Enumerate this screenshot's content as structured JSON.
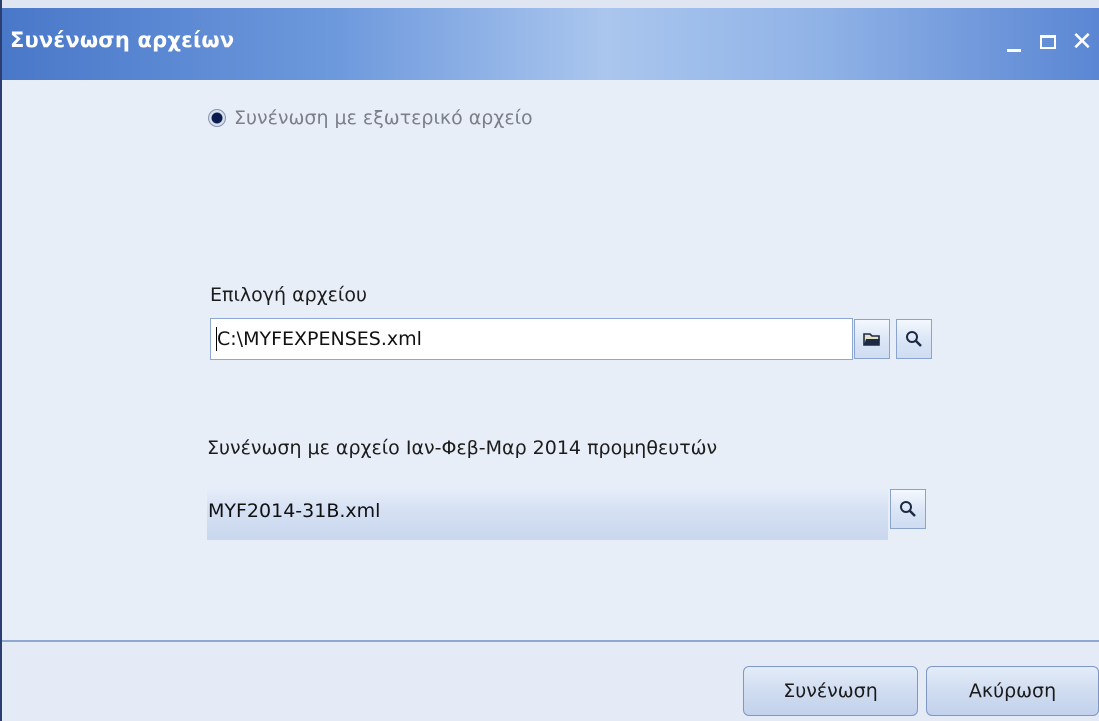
{
  "window": {
    "title": "Συνένωση αρχείων",
    "controls": {
      "minimize": "minimize-icon",
      "maximize": "maximize-icon",
      "close": "close-icon"
    }
  },
  "radio": {
    "label": "Συνένωση με εξωτερικό αρχείο",
    "selected": true
  },
  "file_select": {
    "label": "Επιλογή αρχείου",
    "value": "C:\\MYFEXPENSES.xml",
    "browse_icon": "folder-open-icon",
    "search_icon": "magnifier-icon"
  },
  "merge_with": {
    "label": "Συνένωση με αρχείο Ιαν-Φεβ-Μαρ 2014 προμηθευτών",
    "value": "MYF2014-31B.xml",
    "search_icon": "magnifier-icon"
  },
  "footer": {
    "merge_button": "Συνένωση",
    "cancel_button": "Ακύρωση"
  },
  "colors": {
    "title_text": "#ffffff",
    "window_bg": "#e8eef8",
    "radio_selected": "#0a1a4e"
  }
}
